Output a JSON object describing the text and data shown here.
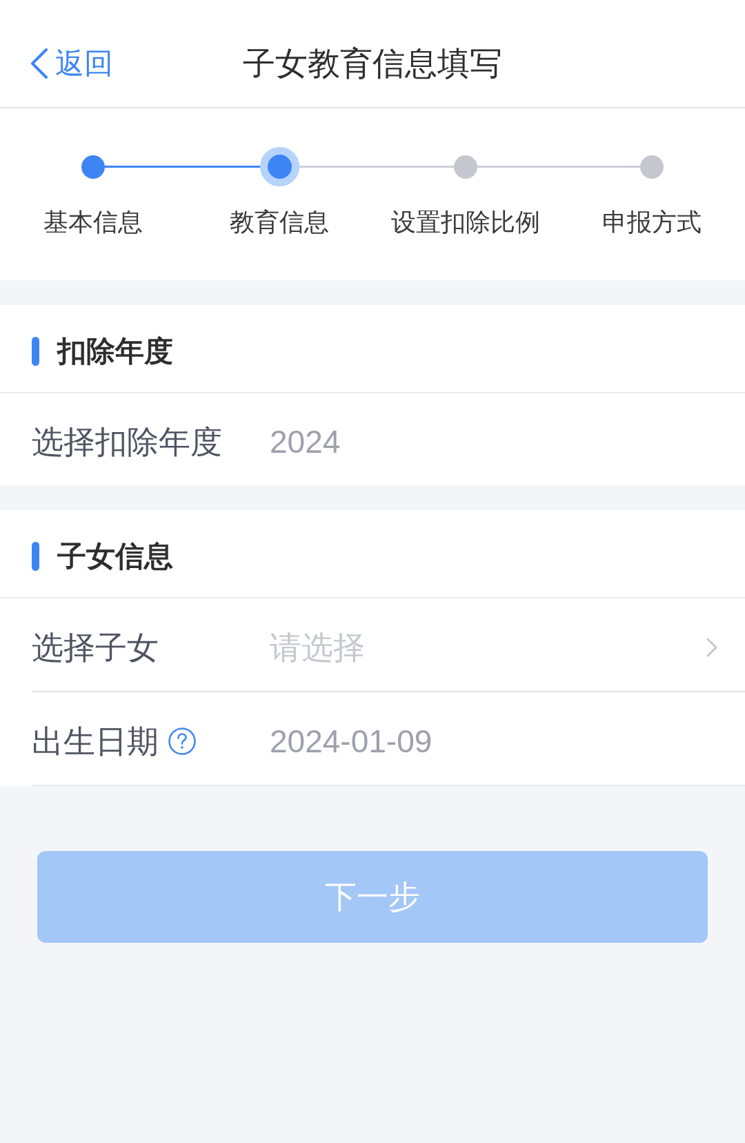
{
  "header": {
    "back": "返回",
    "title": "子女教育信息填写"
  },
  "steps": [
    {
      "label": "基本信息",
      "completed": true,
      "selected": false
    },
    {
      "label": "教育信息",
      "completed": false,
      "selected": true
    },
    {
      "label": "设置扣除比例",
      "completed": false,
      "selected": false
    },
    {
      "label": "申报方式",
      "completed": false,
      "selected": false
    }
  ],
  "sections": [
    {
      "title": "扣除年度",
      "rows": [
        {
          "kind": "value",
          "label": "选择扣除年度",
          "value": "2024"
        }
      ]
    },
    {
      "title": "子女信息",
      "rows": [
        {
          "kind": "select",
          "label": "选择子女",
          "placeholder": "请选择"
        },
        {
          "kind": "value",
          "label": "出生日期",
          "value": "2024-01-09",
          "help": true
        }
      ]
    }
  ],
  "button": {
    "label": "下一步",
    "disabled": true
  }
}
